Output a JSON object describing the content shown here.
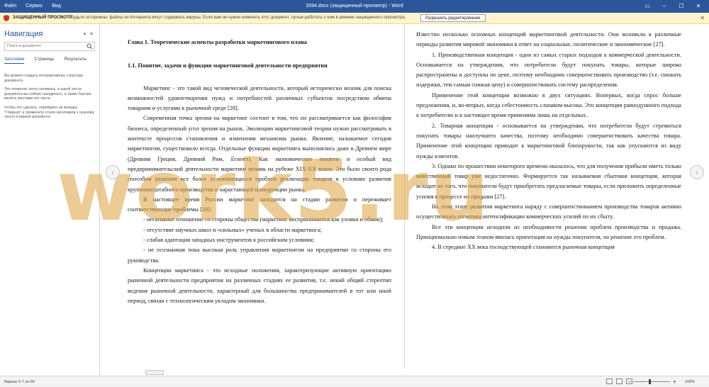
{
  "titlebar": {
    "menu": [
      "Файл",
      "Сервис",
      "Вид"
    ],
    "title": "3394.docx (защищенный просмотр) - Word"
  },
  "protected_view": {
    "label": "ЗАЩИЩЕННЫЙ ПРОСМОТР",
    "message": "Будьте осторожны: файлы из Интернета могут содержать вирусы. Если вам не нужно изменять этот документ, лучше работать с ним в режиме защищенного просмотра.",
    "enable_button": "Разрешить редактирование",
    "close": "✕"
  },
  "navigation": {
    "title": "Навигация",
    "search_placeholder": "Поиск в документе",
    "tabs": [
      "Заголовки",
      "Страницы",
      "Результаты"
    ],
    "help": [
      "Вы можете создать интерактивную структуру документа.",
      "Это позволит легко понимать, в какой части документа вы сейчас находитесь, а также быстро менять местами его части.",
      "Чтобы это сделать, перейдите на вкладку \"Главная\" и примените стили заголовков к нужному тексту в вашем документе."
    ]
  },
  "watermark": "work5.ru",
  "left_page": {
    "chapter": "Глава 1. Теоретические аспекты разработки маркетингового плана",
    "section": "1.1.  Понятие, задачи и функции маркетинговой деятельности предприятия",
    "p1": "Маркетинг - это такой вид человеческой деятельности, который исторически возник для поиска возможностей удовлетворения нужд и потребностей различных субъектов посредством обмена товарами и услугами в рыночной среде [28].",
    "p2": "Современная точка зрения на маркетинг состоит в том, что он рассматривается как философия бизнеса, определенный угол зрения на рынок. Эволюцию маркетинговой теории нужно рассматривать в контексте процессов становления и изменения механизма рынка. Явление, называемое сегодня маркетингом, существовало всегда. Отдельные функции маркетинга выполнялись даже в Древнем мире (Древняя Греция, Древний Рим, Египет). Как экономическое понятие и особый вид предпринимательской деятельности маркетинг возник на рубеже XIX-XX веков. Это было своего рода способом решения все более усложняющихся проблем реализации товаров в условиях развития крупномасштабного производства и нарастающей конкуренции рынка.",
    "p3": "В настоящее время России маркетинг находится на стадии развития и переживает соответствующие проблемы [18]:",
    "li1": "-    негативное отношение со стороны общества (маркетинг воспринимается как уловки и обман);",
    "li2": "- отсутствие научных школ и «сильных» ученых в области маркетинга;",
    "li3": "- слабая адаптация западных инструментов к российским условиям;",
    "li4": "-  не осознанная пока высокая роль управления маркетингом на предприятии со стороны его руководства.",
    "p4": "Концепции маркетинга - это исходные положения, характеризующие активную ориентацию рыночной деятельности предприятия на различных стадиях ее развития, т.е. некий общий стереотип ведения рыночной деятельности, характерный для большинства предпринимателей в тот или иной период, связан с технологическим укладом экономики."
  },
  "right_page": {
    "p1": "Известно несколько основных концепций маркетинговой деятельности. Они возникли в различные периоды развития мировой экономики в ответ на социальные, политические и экономические [27].",
    "p2": "1.  Производственная концепция - одни из самых старых подходов к коммерческой деятельности. Основывается на утверждении, что потребители будут покупать товары, которые широко распространены и доступны по цене, поэтому необходимо совершенствовать производство (т.е. снижать издержки, тем самым снижая цену) и совершенствовать систему распределения.",
    "p3": "Применение этой концепции возможно в двух ситуациях. Вопервых, когда спрос больше предложения, и, во-вторых, когда себестоимость слишком высока. Это концепция равнодушного подхода к потребителю и в настоящее время применима лишь на отдельных.",
    "p4": "2.   Товарная концепция - основывается на утверждении, что потребители будут стремиться покупать товары наилучшего качества, поэтому необходимо совершенствовать качества товара. Применение этой концепции приводит к маркетинговой близорукости, так как упускаются из виду нужды клиентов.",
    "p5": "3.  Однако по прошествии некоторого времени оказалось, что для получения прибыли иметь только качественный товар уже недостаточно. Формируется так называемая сбытовая концепция, которая исходит из того, что покупатели будут приобретать предлагаемые товары, если приложить определенные усилия в процессе их продажи [27].",
    "p6": "На этом этапе развития маркетинга наряду с совершенствованием производства товаров активно осуществлялась политика интенсификации коммерческих усилий по их сбыту.",
    "p7": "Все эти концепции исходили из необходимости решения проблем производства и продажа. Принципиально новым этапом явилась ориентация на нужды покупателя, на решение его проблем.",
    "p8": "4.  В середине XX века господствующей становится рыночная концепция"
  },
  "status": {
    "pages": "Экраны 6-7 из 66",
    "zoom": "100%",
    "zoom_fraction": 0.45
  },
  "colors": {
    "title_bar": "#2b579a",
    "protected_bar": "#fff4ce",
    "watermark": "#dca03c"
  }
}
